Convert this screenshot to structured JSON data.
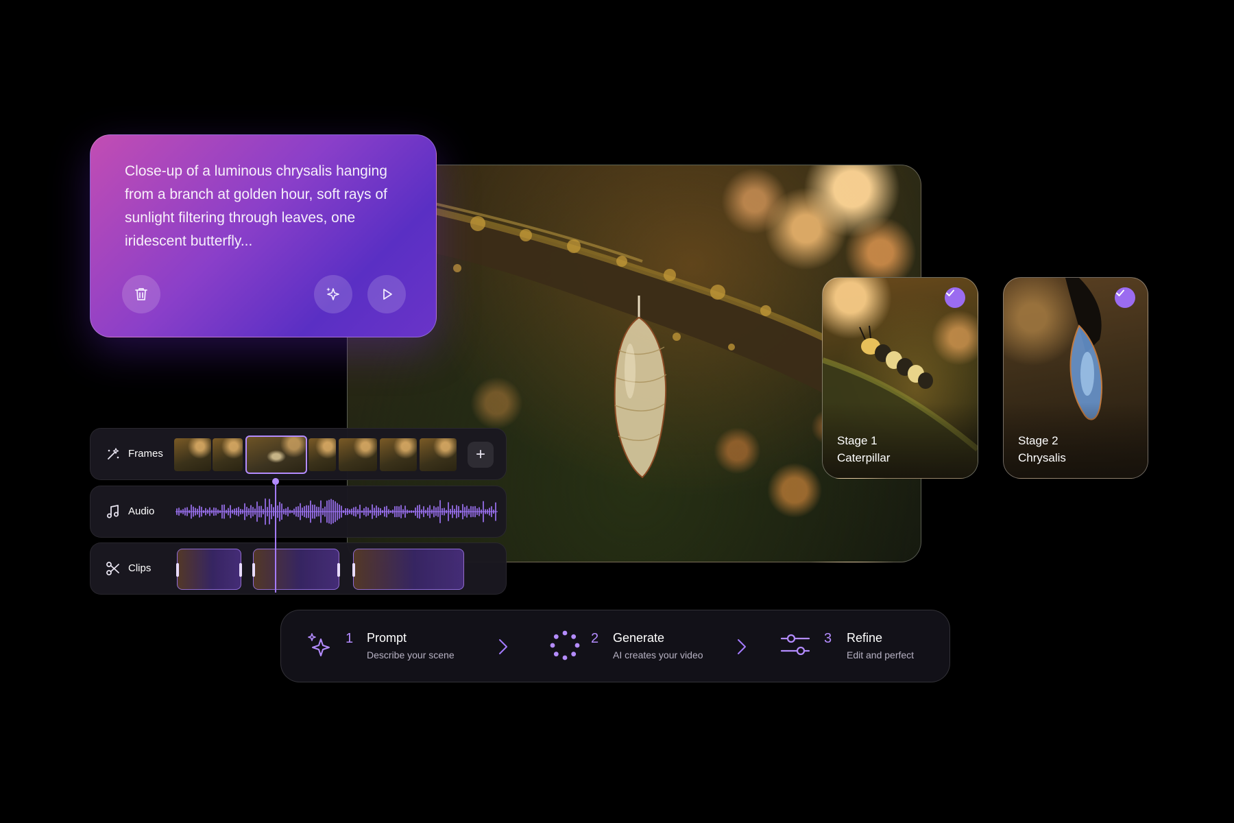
{
  "prompt": {
    "text": "Close-up of a luminous chrysalis hanging from a branch at golden hour, soft rays of sunlight filtering through leaves, one iridescent butterfly..."
  },
  "stages": [
    {
      "label": "Stage 1",
      "name": "Caterpillar"
    },
    {
      "label": "Stage 2",
      "name": "Chrysalis"
    }
  ],
  "timeline": {
    "frames_label": "Frames",
    "audio_label": "Audio",
    "clips_label": "Clips",
    "add_symbol": "+"
  },
  "steps": [
    {
      "number": "1",
      "title": "Prompt",
      "description": "Describe your scene"
    },
    {
      "number": "2",
      "title": "Generate",
      "description": "AI creates your video"
    },
    {
      "number": "3",
      "title": "Refine",
      "description": "Edit and perfect"
    }
  ],
  "colors": {
    "accent": "#b48cff",
    "prompt_gradient_start": "#c24db3",
    "prompt_gradient_end": "#5a2fc4",
    "background": "#000000"
  }
}
